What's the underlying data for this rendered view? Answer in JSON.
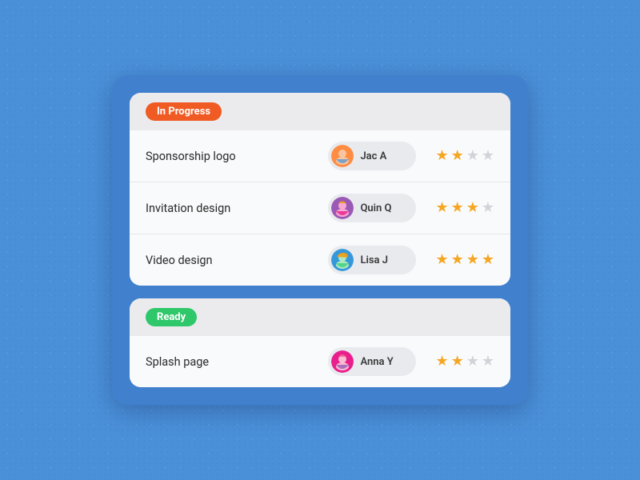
{
  "colors": {
    "background": "#4a90d9",
    "mainCard": "#4080cc",
    "sectionCard": "#f4f5f7",
    "badgeInProgress": "#f05a23",
    "badgeReady": "#2ec76a",
    "starFilled": "#f5a623",
    "starEmpty": "#d0d3d8"
  },
  "sections": [
    {
      "id": "in-progress",
      "badgeLabel": "In Progress",
      "badgeClass": "badge-in-progress",
      "tasks": [
        {
          "id": "sponsorship-logo",
          "name": "Sponsorship logo",
          "assignee": "Jac A",
          "avatarClass": "avatar-jac",
          "starsCount": 2,
          "totalStars": 4
        },
        {
          "id": "invitation-design",
          "name": "Invitation design",
          "assignee": "Quin Q",
          "avatarClass": "avatar-quin",
          "starsCount": 3,
          "totalStars": 4
        },
        {
          "id": "video-design",
          "name": "Video design",
          "assignee": "Lisa J",
          "avatarClass": "avatar-lisa",
          "starsCount": 4,
          "totalStars": 4
        }
      ]
    },
    {
      "id": "ready",
      "badgeLabel": "Ready",
      "badgeClass": "badge-ready",
      "tasks": [
        {
          "id": "splash-page",
          "name": "Splash page",
          "assignee": "Anna Y",
          "avatarClass": "avatar-anna",
          "starsCount": 2,
          "totalStars": 4
        }
      ]
    }
  ]
}
